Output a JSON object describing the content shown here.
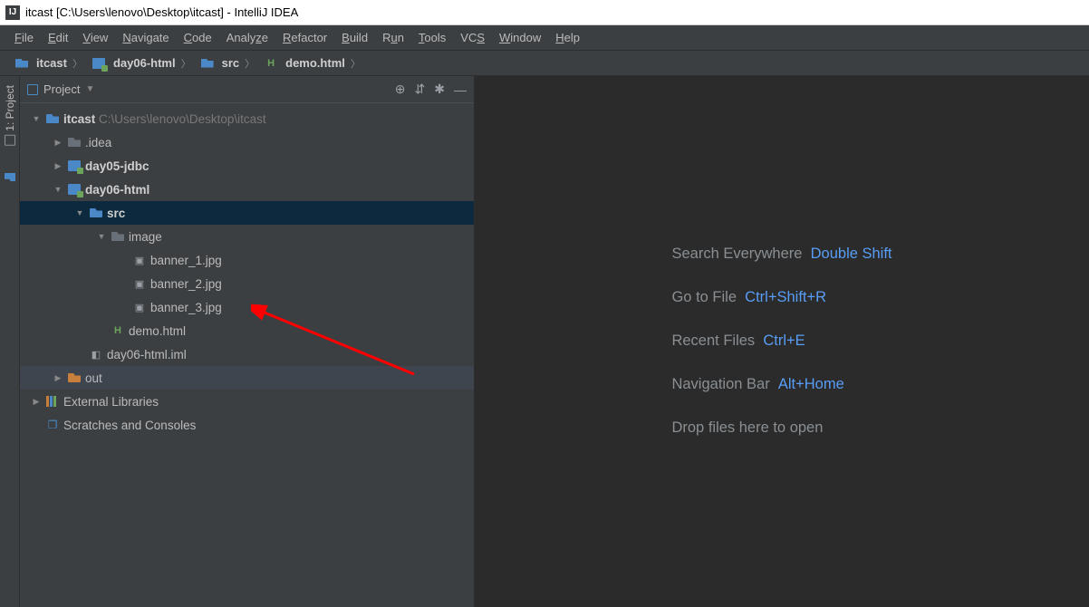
{
  "window": {
    "title": "itcast [C:\\Users\\lenovo\\Desktop\\itcast] - IntelliJ IDEA"
  },
  "menu": {
    "items": [
      "File",
      "Edit",
      "View",
      "Navigate",
      "Code",
      "Analyze",
      "Refactor",
      "Build",
      "Run",
      "Tools",
      "VCS",
      "Window",
      "Help"
    ]
  },
  "breadcrumbs": {
    "items": [
      {
        "icon": "folder",
        "label": "itcast"
      },
      {
        "icon": "module",
        "label": "day06-html"
      },
      {
        "icon": "folder",
        "label": "src"
      },
      {
        "icon": "html",
        "label": "demo.html"
      }
    ]
  },
  "gutter": {
    "tab1": "1: Project"
  },
  "panel": {
    "title": "Project"
  },
  "tree": {
    "root": {
      "label": "itcast",
      "path": "C:\\Users\\lenovo\\Desktop\\itcast"
    },
    "idea": ".idea",
    "day05": "day05-jdbc",
    "day06": "day06-html",
    "src": "src",
    "image": "image",
    "banner1": "banner_1.jpg",
    "banner2": "banner_2.jpg",
    "banner3": "banner_3.jpg",
    "demo": "demo.html",
    "iml": "day06-html.iml",
    "out": "out",
    "extlib": "External Libraries",
    "scratch": "Scratches and Consoles"
  },
  "hints": {
    "search": {
      "label": "Search Everywhere",
      "key": "Double Shift"
    },
    "gotofile": {
      "label": "Go to File",
      "key": "Ctrl+Shift+R"
    },
    "recent": {
      "label": "Recent Files",
      "key": "Ctrl+E"
    },
    "navbar": {
      "label": "Navigation Bar",
      "key": "Alt+Home"
    },
    "drop": {
      "label": "Drop files here to open"
    }
  }
}
